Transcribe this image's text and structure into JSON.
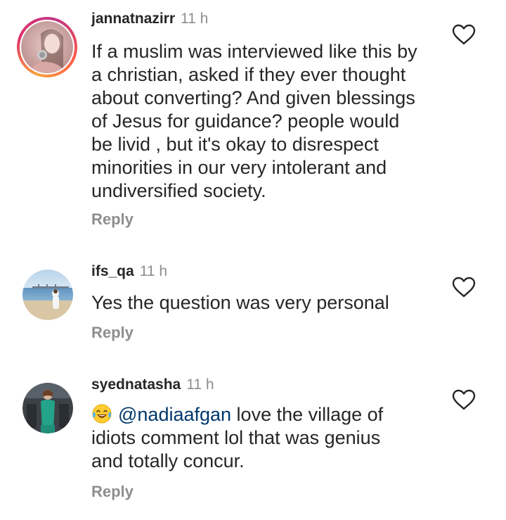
{
  "comments": [
    {
      "username": "jannatnazirr",
      "time": "11 h",
      "lines": [
        "If a muslim was interviewed like this by",
        "a christian, asked if they ever thought",
        "about converting? And given blessings",
        "of Jesus for guidance?  people would",
        "be livid , but it's okay to disrespect",
        "minorities in our very intolerant and",
        "undiversified society."
      ],
      "reply_label": "Reply"
    },
    {
      "username": "ifs_qa",
      "time": "11 h",
      "lines": [
        "Yes the question was very personal"
      ],
      "reply_label": "Reply"
    },
    {
      "username": "syednatasha",
      "time": "11 h",
      "emoji": "face-with-tears-of-joy",
      "mention": "@nadiaafgan",
      "first_line_rest": " love the village of",
      "lines": [
        "idiots comment lol that was genius",
        "and totally concur."
      ],
      "reply_label": "Reply"
    }
  ],
  "colors": {
    "text": "#262626",
    "secondary": "#8e8e8e",
    "mention": "#00376b"
  }
}
